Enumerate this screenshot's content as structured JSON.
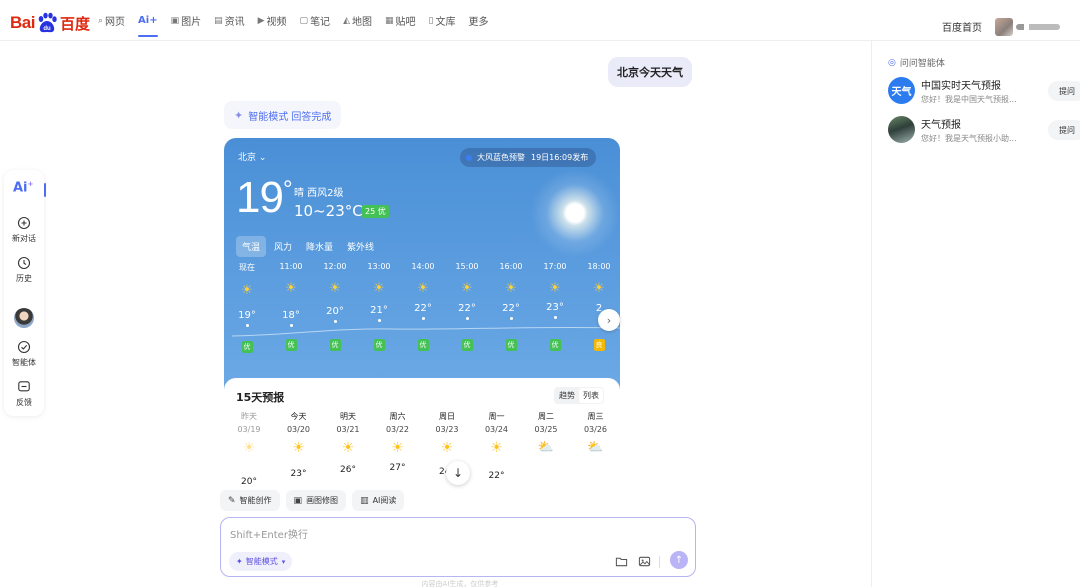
{
  "header": {
    "logo_latin": "Bai",
    "logo_du": "du",
    "logo_cn": "百度",
    "nav": [
      {
        "label": "网页",
        "icon": "search-icon"
      },
      {
        "label": "Ai+",
        "icon": "",
        "active": true
      },
      {
        "label": "图片",
        "icon": "image-icon"
      },
      {
        "label": "资讯",
        "icon": "news-icon"
      },
      {
        "label": "视频",
        "icon": "video-icon"
      },
      {
        "label": "笔记",
        "icon": "note-icon"
      },
      {
        "label": "地图",
        "icon": "map-icon"
      },
      {
        "label": "贴吧",
        "icon": "tieba-icon"
      },
      {
        "label": "文库",
        "icon": "doc-icon"
      },
      {
        "label": "更多",
        "icon": ""
      }
    ],
    "home_link": "百度首页"
  },
  "rail": {
    "ai_label": "Ai",
    "ai_sup": "+",
    "items": [
      {
        "label": "新对话",
        "icon": "new-chat-icon"
      },
      {
        "label": "历史",
        "icon": "clock-icon"
      },
      {
        "label": "智能体",
        "icon": "agent-icon"
      },
      {
        "label": "反馈",
        "icon": "feedback-icon"
      }
    ]
  },
  "chat": {
    "user_query": "北京今天天气",
    "mode_status": "智能模式 回答完成"
  },
  "weather": {
    "location": "北京",
    "alert": "大风蓝色预警",
    "alert_time": "19日16:09发布",
    "current_temp": "19",
    "degree": "°",
    "condition": "晴 西风2级",
    "range": "10~23°C",
    "aqi_now": "25 优",
    "tabs": [
      "气温",
      "风力",
      "降水量",
      "紫外线"
    ],
    "hourly": [
      {
        "time": "现在",
        "temp": "19°",
        "aq": "优"
      },
      {
        "time": "11:00",
        "temp": "18°",
        "aq": "优"
      },
      {
        "time": "12:00",
        "temp": "20°",
        "aq": "优"
      },
      {
        "time": "13:00",
        "temp": "21°",
        "aq": "优"
      },
      {
        "time": "14:00",
        "temp": "22°",
        "aq": "优"
      },
      {
        "time": "15:00",
        "temp": "22°",
        "aq": "优"
      },
      {
        "time": "16:00",
        "temp": "22°",
        "aq": "优"
      },
      {
        "time": "17:00",
        "temp": "23°",
        "aq": "优"
      },
      {
        "time": "18:00",
        "temp": "2",
        "aq": "良"
      }
    ],
    "aq_colors": {
      "优": "#44c155",
      "良": "#f5b800"
    },
    "forecast_title": "15天预报",
    "forecast_toggle": [
      "趋势",
      "列表"
    ],
    "days": [
      {
        "day": "昨天",
        "date": "03/19",
        "temp": "20°",
        "icon": "sun-icon",
        "past": true
      },
      {
        "day": "今天",
        "date": "03/20",
        "temp": "23°",
        "icon": "sun-icon"
      },
      {
        "day": "明天",
        "date": "03/21",
        "temp": "26°",
        "icon": "sun-icon"
      },
      {
        "day": "周六",
        "date": "03/22",
        "temp": "27°",
        "icon": "sun-icon"
      },
      {
        "day": "周日",
        "date": "03/23",
        "temp": "24°",
        "icon": "sun-icon"
      },
      {
        "day": "周一",
        "date": "03/24",
        "temp": "22°",
        "icon": "sun-icon"
      },
      {
        "day": "周二",
        "date": "03/25",
        "temp": "",
        "icon": "partly-cloudy-icon"
      },
      {
        "day": "周三",
        "date": "03/26",
        "temp": "",
        "icon": "partly-cloudy-icon"
      }
    ]
  },
  "tools": [
    {
      "label": "智能创作",
      "icon": "pen-icon"
    },
    {
      "label": "画图修图",
      "icon": "picture-icon"
    },
    {
      "label": "AI阅读",
      "icon": "book-icon"
    }
  ],
  "input": {
    "placeholder": "Shift+Enter换行",
    "mode": "智能模式",
    "footer": "内容由AI生成，仅供参考"
  },
  "right_panel": {
    "title": "问问智能体",
    "agents": [
      {
        "name": "中国实时天气预报",
        "desc": "您好！我是中国天气预报...",
        "avatar_text": "天气",
        "ask": "提问"
      },
      {
        "name": "天气预报",
        "desc": "您好！我是天气预报小助...",
        "avatar_text": "",
        "ask": "提问"
      }
    ]
  }
}
